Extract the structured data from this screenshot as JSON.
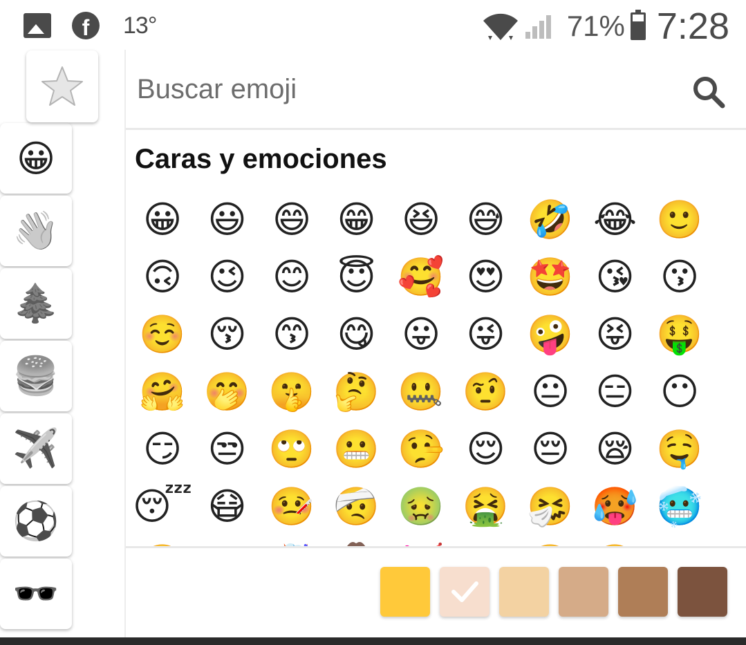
{
  "status_bar": {
    "temperature": "13°",
    "battery": "71%",
    "time": "7:28",
    "icons": [
      "image-icon",
      "facebook-icon",
      "wifi-icon",
      "signal-icon",
      "battery-icon"
    ]
  },
  "categories": [
    {
      "name": "recent",
      "glyph": "star-icon"
    },
    {
      "name": "caras",
      "glyph": "😀"
    },
    {
      "name": "personas",
      "glyph": "👋"
    },
    {
      "name": "naturaleza",
      "glyph": "🌲"
    },
    {
      "name": "comida",
      "glyph": "🍔"
    },
    {
      "name": "viajes",
      "glyph": "✈️"
    },
    {
      "name": "actividades",
      "glyph": "⚽"
    },
    {
      "name": "objetos",
      "glyph": "🕶️"
    }
  ],
  "search": {
    "placeholder": "Buscar emoji"
  },
  "section_title": "Caras y emociones",
  "emojis": [
    [
      "😀",
      "😃",
      "😄",
      "😁",
      "😆",
      "😅",
      "🤣",
      "😂",
      "🙂"
    ],
    [
      "🙃",
      "😉",
      "😊",
      "😇",
      "🥰",
      "😍",
      "🤩",
      "😘",
      "😗"
    ],
    [
      "☺️",
      "😚",
      "😙",
      "😋",
      "😛",
      "😜",
      "🤪",
      "😝",
      "🤑"
    ],
    [
      "🤗",
      "🤭",
      "🤫",
      "🤔",
      "🤐",
      "🤨",
      "😐",
      "😑",
      "😶"
    ],
    [
      "😏",
      "😒",
      "🙄",
      "😬",
      "🤥",
      "😌",
      "😔",
      "😪",
      "🤤"
    ],
    [
      "😴",
      "😷",
      "🤒",
      "🤕",
      "🤢",
      "🤮",
      "🤧",
      "🥵",
      "🥶"
    ],
    [
      "🥴",
      "😵",
      "🤯",
      "🤠",
      "🥳",
      "😎",
      "🤓",
      "🧐",
      "😕"
    ]
  ],
  "skin_tones": [
    {
      "name": "default",
      "color": "#FFC93A",
      "selected": false
    },
    {
      "name": "light",
      "color": "#F7DECE",
      "selected": true
    },
    {
      "name": "medium-light",
      "color": "#F3D2A2",
      "selected": false
    },
    {
      "name": "medium",
      "color": "#D5AB88",
      "selected": false
    },
    {
      "name": "medium-dark",
      "color": "#AF7E57",
      "selected": false
    },
    {
      "name": "dark",
      "color": "#7C533E",
      "selected": false
    }
  ]
}
